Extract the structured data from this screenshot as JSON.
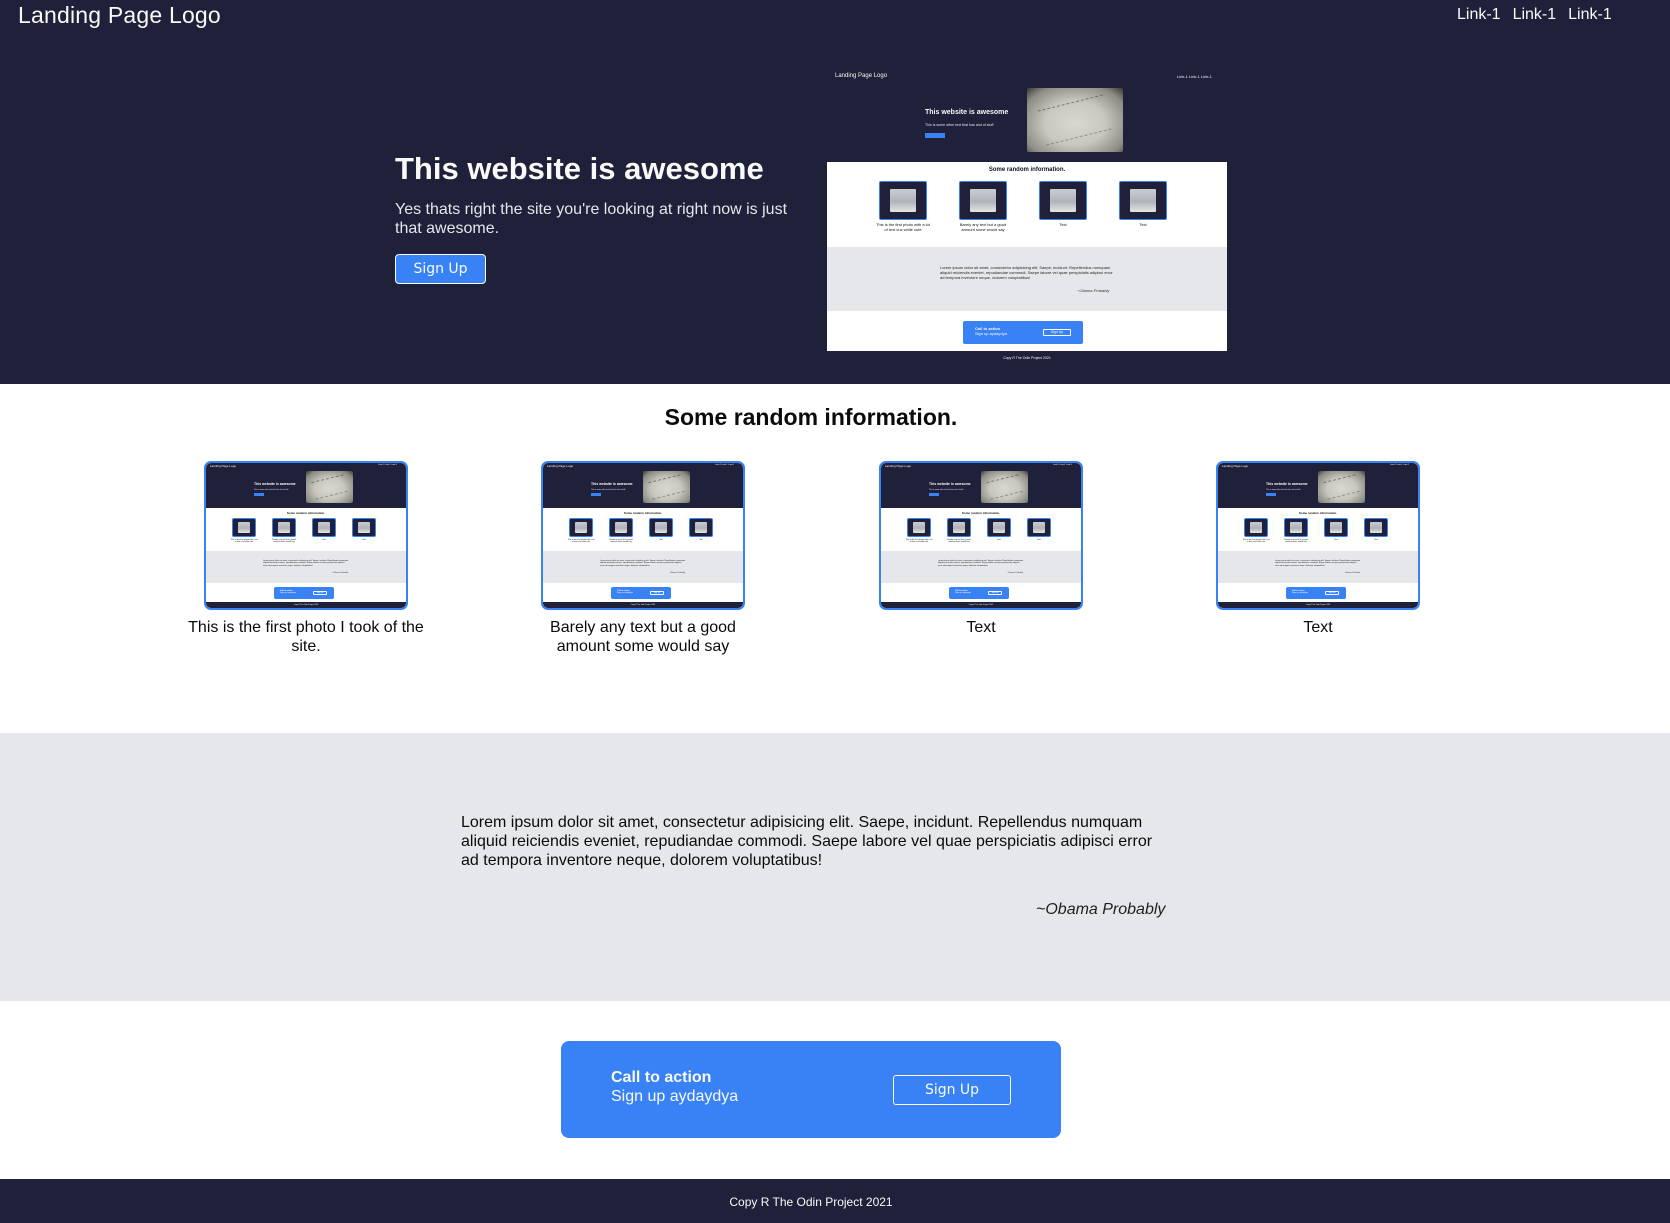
{
  "header": {
    "logo": "Landing Page Logo",
    "links": [
      "Link-1",
      "Link-1",
      "Link-1"
    ]
  },
  "hero": {
    "title": "This website is awesome",
    "subtitle": "Yes thats right the site you're looking at right now is just that awesome.",
    "signup_label": "Sign Up"
  },
  "hero_screenshot": {
    "logo": "Landing Page Logo",
    "links": "Link-1  Link-1  Link-1",
    "title": "This website is awesome",
    "subtitle": "This is some other text that has alot of stuff",
    "info_title": "Some random information.",
    "captions": [
      "This is the first photo with a lot of text cuz while cute",
      "Barely any text but a good amount some would say",
      "Text",
      "Text"
    ],
    "quote": "Lorem ipsum dolor sit amet, consectetur adipisicing elit. Saepe, incidunt. Repellendus numquam aliquid reiciendis eveniet, repudiandae commodi. Saepe labore vel quae perspiciatis adipisci error ad tempora inventore neque, dolorem voluptatibus!",
    "author": "~Obama Probably",
    "cta_title": "Call to action",
    "cta_sub": "Sign up aydaydya",
    "cta_button": "Sign Up",
    "footer": "Copy R The Odin Project 2021"
  },
  "info": {
    "title": "Some random information.",
    "cards": [
      {
        "caption": "This is the first photo I took of the site."
      },
      {
        "caption": "Barely any text but a good amount some would say"
      },
      {
        "caption": "Text"
      },
      {
        "caption": "Text"
      }
    ]
  },
  "quote": {
    "text": "Lorem ipsum dolor sit amet, consectetur adipisicing elit. Saepe, incidunt. Repellendus numquam aliquid reiciendis eveniet, repudiandae commodi. Saepe labore vel quae perspiciatis adipisci error ad tempora inventore neque, dolorem voluptatibus!",
    "author": "~Obama Probably"
  },
  "cta": {
    "title": "Call to action",
    "subtitle": "Sign up aydaydya",
    "button": "Sign Up"
  },
  "footer": {
    "text": "Copy R The Odin Project 2021"
  },
  "colors": {
    "dark": "#1f2039",
    "accent": "#3882f6",
    "light_text": "#f9faf8",
    "quote_bg": "#e5e7eb"
  }
}
